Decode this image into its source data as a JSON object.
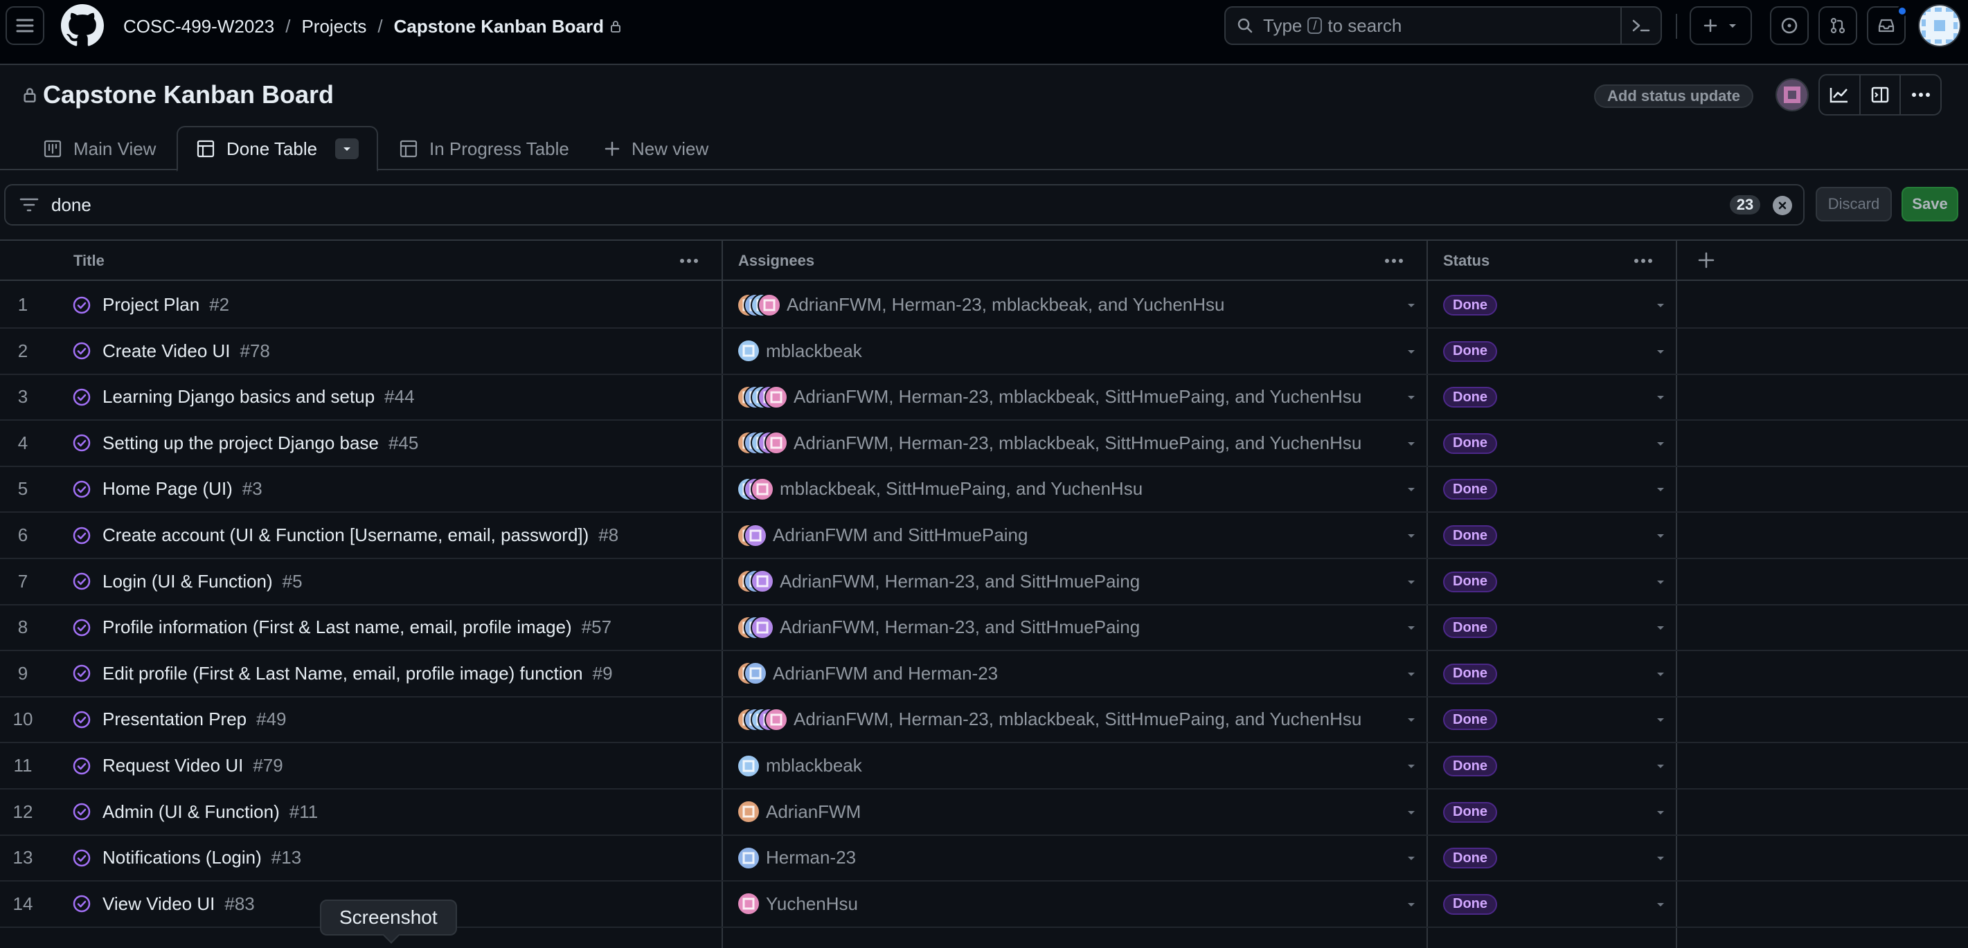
{
  "header": {
    "breadcrumb": {
      "org": "COSC-499-W2023",
      "projects": "Projects",
      "project": "Capstone Kanban Board",
      "sep1": "/",
      "sep2": "/"
    },
    "search": {
      "prefix": "Type",
      "kbd": "/",
      "suffix": "to search"
    }
  },
  "project": {
    "title": "Capstone Kanban Board",
    "status_update_label": "Add status update"
  },
  "tabs": [
    {
      "label": "Main View",
      "icon": "board-icon"
    },
    {
      "label": "Done Table",
      "icon": "table-icon",
      "active": true
    },
    {
      "label": "In Progress Table",
      "icon": "table-icon"
    },
    {
      "label": "New view",
      "icon": "plus-icon"
    }
  ],
  "filter": {
    "query": "done",
    "count": "23",
    "discard_label": "Discard",
    "save_label": "Save"
  },
  "table": {
    "columns": [
      "Title",
      "Assignees",
      "Status"
    ],
    "rows": [
      {
        "num": "1",
        "title": "Project Plan",
        "issue": "#2",
        "assignees": "AdrianFWM, Herman-23, mblackbeak, and YuchenHsu",
        "avatars": [
          "a",
          "h",
          "m",
          "y"
        ],
        "status": "Done"
      },
      {
        "num": "2",
        "title": "Create Video UI",
        "issue": "#78",
        "assignees": "mblackbeak",
        "avatars": [
          "m"
        ],
        "status": "Done"
      },
      {
        "num": "3",
        "title": "Learning Django basics and setup",
        "issue": "#44",
        "assignees": "AdrianFWM, Herman-23, mblackbeak, SittHmuePaing, and YuchenHsu",
        "avatars": [
          "a",
          "h",
          "m",
          "s",
          "y"
        ],
        "status": "Done"
      },
      {
        "num": "4",
        "title": "Setting up the project Django base",
        "issue": "#45",
        "assignees": "AdrianFWM, Herman-23, mblackbeak, SittHmuePaing, and YuchenHsu",
        "avatars": [
          "a",
          "h",
          "m",
          "s",
          "y"
        ],
        "status": "Done"
      },
      {
        "num": "5",
        "title": "Home Page (UI)",
        "issue": "#3",
        "assignees": "mblackbeak, SittHmuePaing, and YuchenHsu",
        "avatars": [
          "m",
          "s",
          "y"
        ],
        "status": "Done"
      },
      {
        "num": "6",
        "title": "Create account (UI & Function [Username, email, password])",
        "issue": "#8",
        "assignees": "AdrianFWM and SittHmuePaing",
        "avatars": [
          "a",
          "s"
        ],
        "status": "Done"
      },
      {
        "num": "7",
        "title": "Login (UI & Function)",
        "issue": "#5",
        "assignees": "AdrianFWM, Herman-23, and SittHmuePaing",
        "avatars": [
          "a",
          "h",
          "s"
        ],
        "status": "Done"
      },
      {
        "num": "8",
        "title": "Profile information (First & Last name, email, profile image)",
        "issue": "#57",
        "assignees": "AdrianFWM, Herman-23, and SittHmuePaing",
        "avatars": [
          "a",
          "h",
          "s"
        ],
        "status": "Done"
      },
      {
        "num": "9",
        "title": "Edit profile (First & Last Name, email, profile image) function",
        "issue": "#9",
        "assignees": "AdrianFWM and Herman-23",
        "avatars": [
          "a",
          "h"
        ],
        "status": "Done"
      },
      {
        "num": "10",
        "title": "Presentation Prep",
        "issue": "#49",
        "assignees": "AdrianFWM, Herman-23, mblackbeak, SittHmuePaing, and YuchenHsu",
        "avatars": [
          "a",
          "h",
          "m",
          "s",
          "y"
        ],
        "status": "Done"
      },
      {
        "num": "11",
        "title": "Request Video UI",
        "issue": "#79",
        "assignees": "mblackbeak",
        "avatars": [
          "m"
        ],
        "status": "Done"
      },
      {
        "num": "12",
        "title": "Admin (UI & Function)",
        "issue": "#11",
        "assignees": "AdrianFWM",
        "avatars": [
          "a"
        ],
        "status": "Done"
      },
      {
        "num": "13",
        "title": "Notifications (Login)",
        "issue": "#13",
        "assignees": "Herman-23",
        "avatars": [
          "h"
        ],
        "status": "Done"
      },
      {
        "num": "14",
        "title": "View Video UI",
        "issue": "#83",
        "assignees": "YuchenHsu",
        "avatars": [
          "y"
        ],
        "status": "Done"
      }
    ]
  },
  "tooltip": "Screenshot",
  "colors": {
    "background": "#0d1117",
    "border": "#30363d",
    "muted_text": "#9198a1",
    "issue_closed": "#a371f7",
    "done_badge_bg": "#2d1b4e",
    "done_badge_text": "#d2a8ff",
    "save_green": "#238636",
    "notification_dot": "#1f6feb"
  },
  "avatar_colors": {
    "a": "#e0a27a",
    "h": "#8fb3e8",
    "m": "#9cc7f0",
    "s": "#b388e8",
    "y": "#e48bbd"
  }
}
